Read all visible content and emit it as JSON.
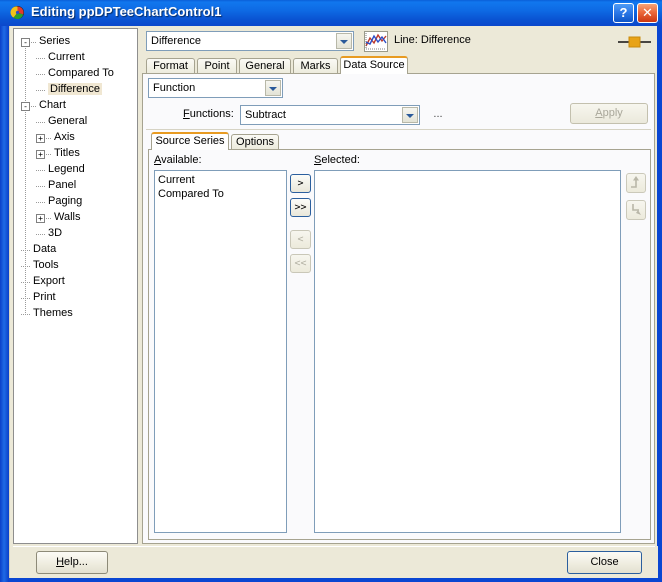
{
  "window": {
    "title": "Editing ppDPTeeChartControl1",
    "icon": "chart-app-icon",
    "help_button": "?",
    "close_button": "✕",
    "titlebar_color": "#0e6ae4"
  },
  "tree": {
    "nodes": [
      {
        "label": "Series",
        "level": 0,
        "expander": "-",
        "selected": false
      },
      {
        "label": "Current",
        "level": 1,
        "expander": "",
        "selected": false
      },
      {
        "label": "Compared To",
        "level": 1,
        "expander": "",
        "selected": false
      },
      {
        "label": "Difference",
        "level": 1,
        "expander": "",
        "selected": true
      },
      {
        "label": "Chart",
        "level": 0,
        "expander": "-",
        "selected": false
      },
      {
        "label": "General",
        "level": 1,
        "expander": "",
        "selected": false
      },
      {
        "label": "Axis",
        "level": 1,
        "expander": "+",
        "selected": false
      },
      {
        "label": "Titles",
        "level": 1,
        "expander": "+",
        "selected": false
      },
      {
        "label": "Legend",
        "level": 1,
        "expander": "",
        "selected": false
      },
      {
        "label": "Panel",
        "level": 1,
        "expander": "",
        "selected": false
      },
      {
        "label": "Paging",
        "level": 1,
        "expander": "",
        "selected": false
      },
      {
        "label": "Walls",
        "level": 1,
        "expander": "+",
        "selected": false
      },
      {
        "label": "3D",
        "level": 1,
        "expander": "",
        "selected": false
      },
      {
        "label": "Data",
        "level": 0,
        "expander": "",
        "selected": false
      },
      {
        "label": "Tools",
        "level": 0,
        "expander": "",
        "selected": false
      },
      {
        "label": "Export",
        "level": 0,
        "expander": "",
        "selected": false
      },
      {
        "label": "Print",
        "level": 0,
        "expander": "",
        "selected": false
      },
      {
        "label": "Themes",
        "level": 0,
        "expander": "",
        "selected": false
      }
    ],
    "selection_color": "#f0e7d2"
  },
  "toolbar": {
    "series_combo_value": "Difference",
    "chart_icon": "line-chart-icon",
    "series_description": "Line: Difference",
    "series_preview": "orange-square-marker",
    "preview_color": "#e8a317"
  },
  "tabs": {
    "items": [
      {
        "label": "Format",
        "active": false
      },
      {
        "label": "Point",
        "active": false
      },
      {
        "label": "General",
        "active": false
      },
      {
        "label": "Marks",
        "active": false
      },
      {
        "label": "Data Source",
        "active": true
      }
    ],
    "active_border_color": "#e89b22"
  },
  "datasource": {
    "mode_combo_value": "Function",
    "functions_label": "Functions:",
    "functions_label_accel": "F",
    "functions_combo_value": "Subtract",
    "ellipsis_button": "...",
    "apply_button": "Apply",
    "apply_button_accel": "A",
    "apply_enabled": false
  },
  "subtabs": {
    "items": [
      {
        "label": "Source Series",
        "active": true
      },
      {
        "label": "Options",
        "active": false
      }
    ]
  },
  "source_series": {
    "available_label": "Available:",
    "available_label_accel": "A",
    "selected_label": "Selected:",
    "selected_label_accel": "S",
    "available_items": [
      "Current",
      "Compared To"
    ],
    "selected_items": [],
    "transfer_buttons": [
      {
        "label": ">",
        "name": "move-right-button",
        "enabled": true
      },
      {
        "label": ">>",
        "name": "move-all-right-button",
        "enabled": true
      },
      {
        "label": "<",
        "name": "move-left-button",
        "enabled": false
      },
      {
        "label": "<<",
        "name": "move-all-left-button",
        "enabled": false
      }
    ],
    "order_buttons": [
      {
        "name": "move-up-button",
        "icon": "arrow-step-up-icon",
        "enabled": false
      },
      {
        "name": "move-down-button",
        "icon": "arrow-step-down-icon",
        "enabled": false
      }
    ]
  },
  "footer": {
    "help_button": "Help...",
    "help_button_accel": "H",
    "close_button": "Close",
    "default_button": "Close"
  }
}
